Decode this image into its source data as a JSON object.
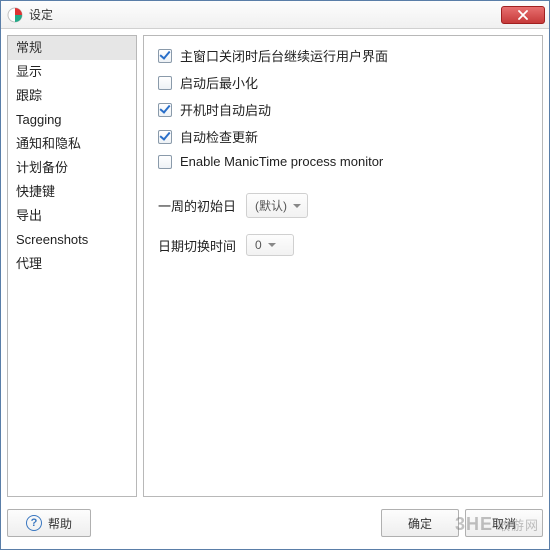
{
  "window": {
    "title": "设定"
  },
  "sidebar": {
    "items": [
      {
        "label": "常规",
        "selected": true
      },
      {
        "label": "显示"
      },
      {
        "label": "跟踪"
      },
      {
        "label": "Tagging"
      },
      {
        "label": "通知和隐私"
      },
      {
        "label": "计划备份"
      },
      {
        "label": "快捷键"
      },
      {
        "label": "导出"
      },
      {
        "label": "Screenshots"
      },
      {
        "label": "代理"
      }
    ]
  },
  "content": {
    "checks": [
      {
        "name": "run-after-close",
        "label": "主窗口关闭时后台继续运行用户界面",
        "checked": true
      },
      {
        "name": "minimize-after-start",
        "label": "启动后最小化",
        "checked": false
      },
      {
        "name": "autostart",
        "label": "开机时自动启动",
        "checked": true
      },
      {
        "name": "auto-update",
        "label": "自动检查更新",
        "checked": true
      },
      {
        "name": "process-monitor",
        "label": "Enable ManicTime process monitor",
        "checked": false
      }
    ],
    "week_start": {
      "label": "一周的初始日",
      "value": "(默认)"
    },
    "day_switch": {
      "label": "日期切换时间",
      "value": "0"
    }
  },
  "footer": {
    "help": "帮助",
    "ok": "确定",
    "cancel": "取消"
  },
  "watermark": {
    "brand": "3HE",
    "site": "敢游网"
  }
}
